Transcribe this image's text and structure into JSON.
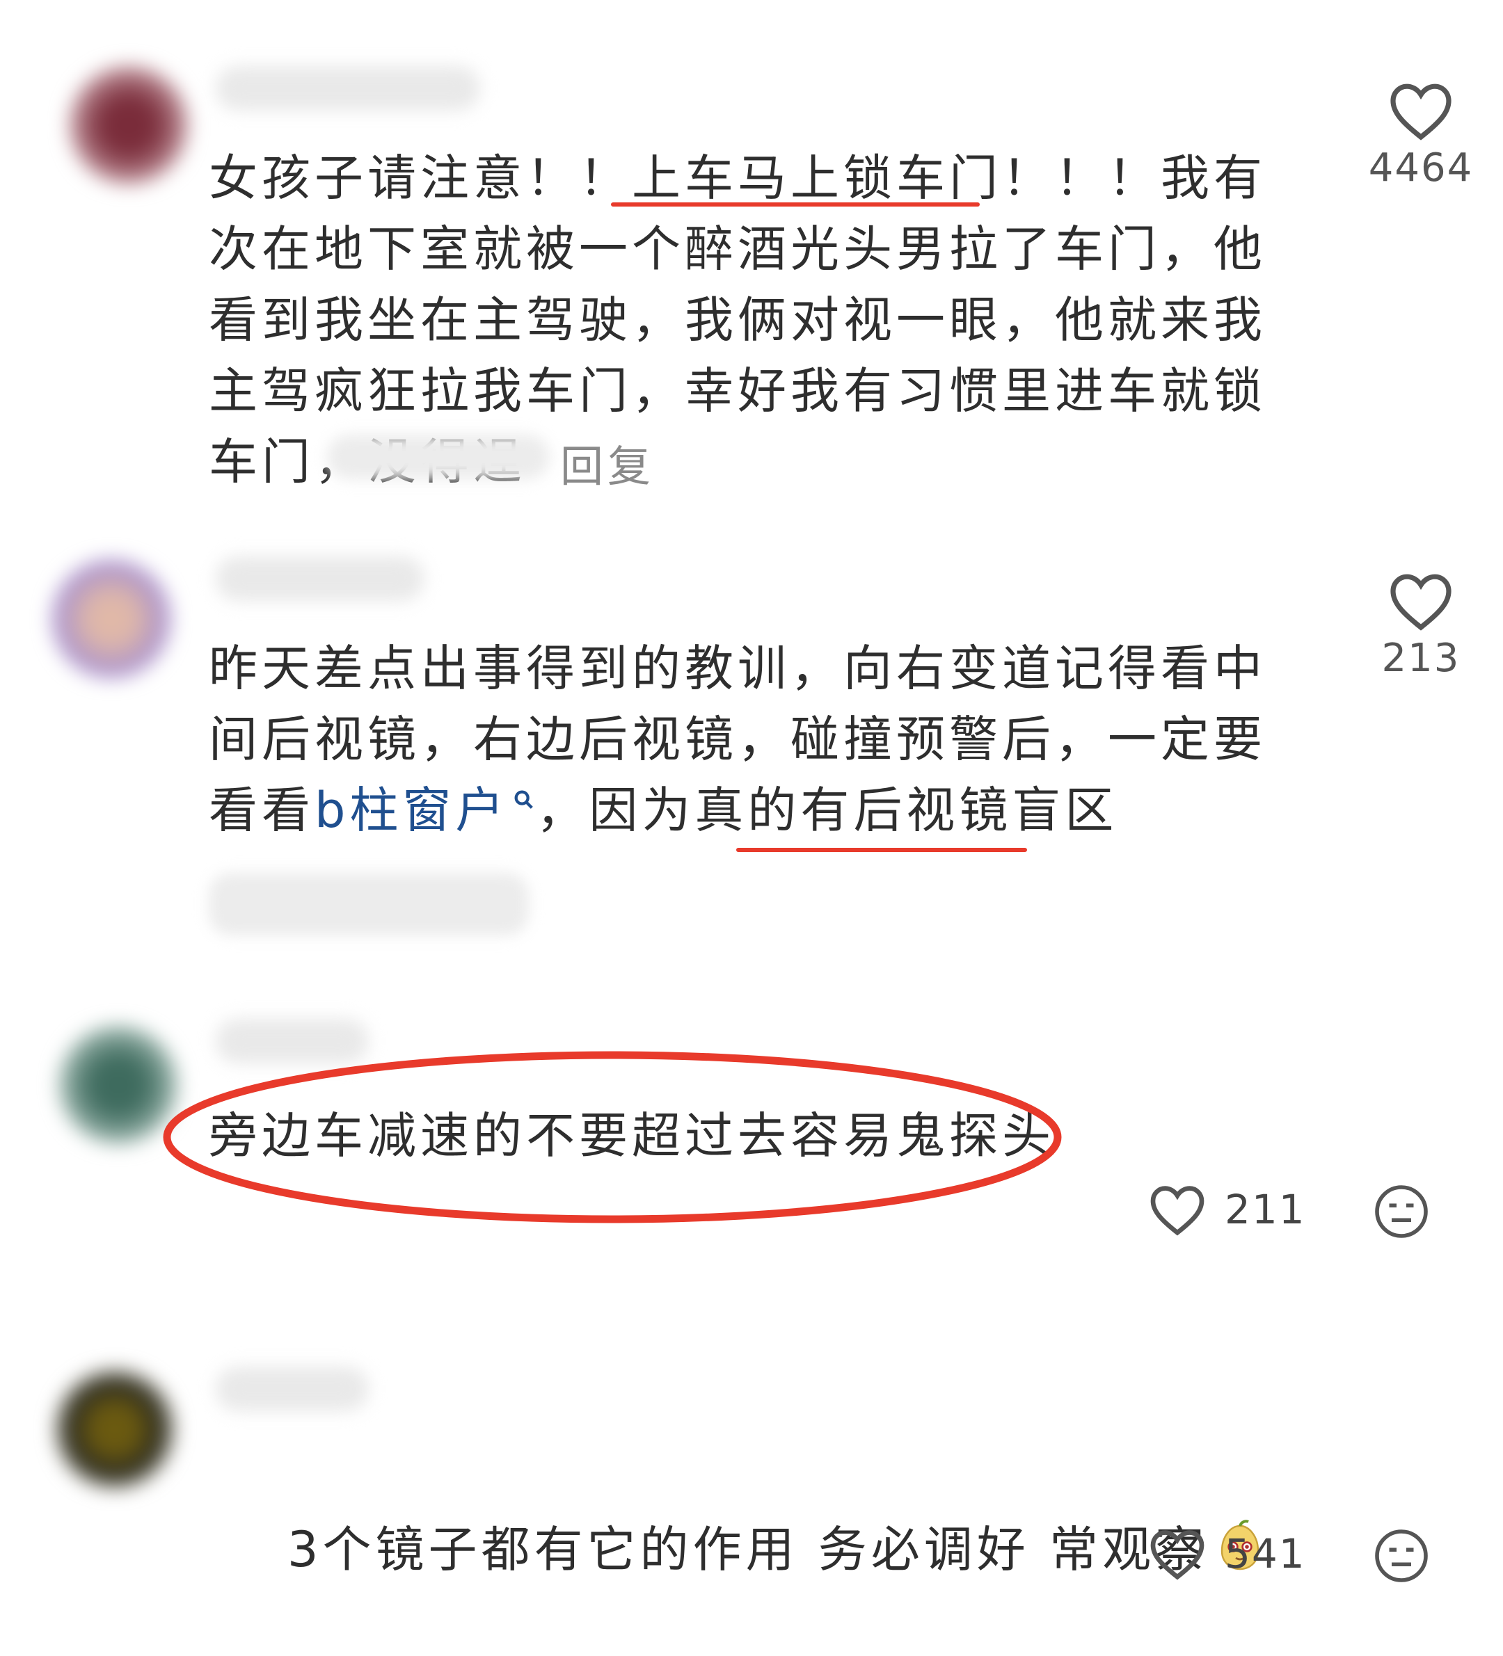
{
  "comments": [
    {
      "text_pre": "女孩子请注意！！",
      "text_highlight": "上车马上锁车门",
      "text_post": "！！！我有次在地下室就被一个醉酒光头男拉了车门，他看到我坐在主驾驶，我俩对视一眼，他就来我主驾疯狂拉我车门，幸好我有习惯里进车就锁车门，没得逞",
      "reply_label": "回复",
      "likes": "4464"
    },
    {
      "text_pre": "昨天差点出事得到的教训，向右变道记得看中间后视镜，右边后视镜，碰撞预警后，一定要看看",
      "link_text": "b柱窗户",
      "text_post": "，因为真的有",
      "text_highlight": "后视镜盲区",
      "likes": "213"
    },
    {
      "text": "旁边车减速的不要超过去容易鬼探头",
      "likes": "211"
    },
    {
      "text": "3个镜子都有它的作用  务必调好 常观察",
      "likes": "541"
    }
  ],
  "colors": {
    "annotation_red": "#e83a2b",
    "link_blue": "#1f4f8f",
    "text": "#2e2e2e"
  },
  "icons": [
    "heart-icon",
    "dislike-face-icon",
    "search-icon",
    "pear-emoji-icon"
  ]
}
